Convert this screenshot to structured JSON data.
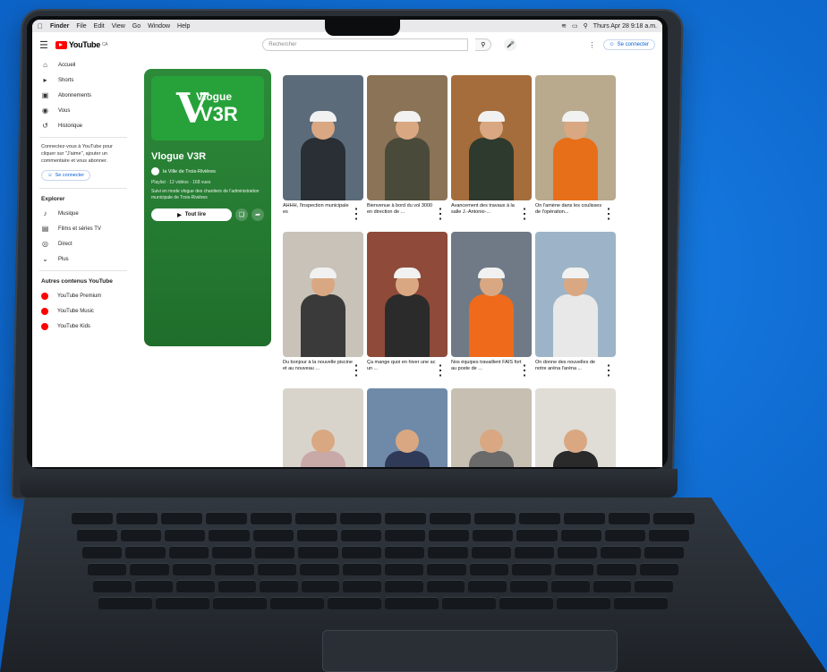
{
  "menubar": {
    "items": [
      "Finder",
      "File",
      "Edit",
      "View",
      "Go",
      "Window",
      "Help"
    ],
    "clock": "Thurs Apr 28 9:18 a.m."
  },
  "header": {
    "logo_text": "YouTube",
    "logo_sup": "CA",
    "search_placeholder": "Rechercher",
    "signin": "Se connecter"
  },
  "sidebar": {
    "items": [
      {
        "label": "Accueil",
        "icon": "home-icon"
      },
      {
        "label": "Shorts",
        "icon": "shorts-icon"
      },
      {
        "label": "Abonnements",
        "icon": "subscriptions-icon"
      },
      {
        "label": "Vous",
        "icon": "you-icon"
      },
      {
        "label": "Historique",
        "icon": "history-icon"
      }
    ],
    "signin_text": "Connectez-vous à YouTube pour cliquer sur \"J'aime\", ajouter un commentaire et vous abonner.",
    "signin_button": "Se connecter",
    "explore_title": "Explorer",
    "explore": [
      {
        "label": "Musique",
        "icon": "music-icon"
      },
      {
        "label": "Films et séries TV",
        "icon": "film-icon"
      },
      {
        "label": "Direct",
        "icon": "live-icon"
      },
      {
        "label": "Plus",
        "icon": "chevron-down-icon"
      }
    ],
    "more_title": "Autres contenus YouTube",
    "more": [
      "YouTube Premium",
      "YouTube Music",
      "YouTube Kids"
    ]
  },
  "playlist": {
    "logo_small": "Vlogue",
    "logo_big": "V3R",
    "title": "Vlogue V3R",
    "owner": "la Ville de Trois-Rivières",
    "meta": "Playlist · 12 vidéos · 168 vues",
    "description": "Suivi en mode vlogue des chantiers de l'administration municipale de Trois-Rivières",
    "play_label": "Tout lire"
  },
  "videos": [
    {
      "title": "AHHH, l'inspection municipale es",
      "bg": "#5b6b7a",
      "body": "#2a2f35"
    },
    {
      "title": "Bienvenue à bord du vol 3000 en direction de ...",
      "bg": "#8a7356",
      "body": "#4a4a3a"
    },
    {
      "title": "Avancement des travaux à la salle J.-Antonio-...",
      "bg": "#a56d3c",
      "body": "#2e3a2e"
    },
    {
      "title": "On l'amène dans les coulisses de l'opération...",
      "bg": "#b9a98d",
      "body": "#e86f1a"
    },
    {
      "title": "Du bonjour à la nouvelle piscine et au nouveau ...",
      "bg": "#c8c2b8",
      "body": "#3a3a3a"
    },
    {
      "title": "Ça mange quoi en hiver une ac un ...",
      "bg": "#8f4a3a",
      "body": "#2b2b2b"
    },
    {
      "title": "Nos équipes travaillent FAIS fort au poste de ...",
      "bg": "#6f7a86",
      "body": "#ef6a1a"
    },
    {
      "title": "On donne des nouvelles de notre aréna l'aréna ...",
      "bg": "#9db4c8",
      "body": "#e8e8e8"
    },
    {
      "title": "",
      "bg": "#d8d4cc",
      "body": "#c9a8a8"
    },
    {
      "title": "",
      "bg": "#6f8aa8",
      "body": "#2f3a58"
    },
    {
      "title": "",
      "bg": "#c7bfb2",
      "body": "#6a6a6a"
    },
    {
      "title": "",
      "bg": "#e0dcd6",
      "body": "#2a2a2a"
    }
  ]
}
